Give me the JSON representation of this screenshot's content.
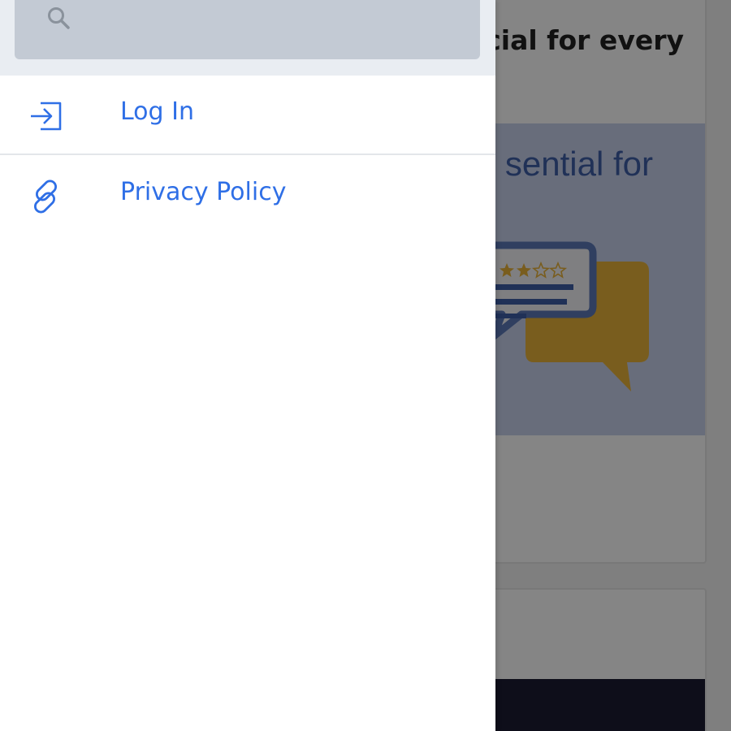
{
  "drawer": {
    "search": {
      "value": "",
      "placeholder": "",
      "icon": "search-icon"
    },
    "items": [
      {
        "label": "Log In",
        "icon": "login-icon"
      },
      {
        "label": "Privacy Policy",
        "icon": "link-icon"
      }
    ]
  },
  "background": {
    "card_title": "cial for every",
    "hero_text": "sential for",
    "rating_stars_filled": 2,
    "rating_stars_total": 5
  },
  "colors": {
    "accent": "#2f6fe6",
    "search_bg": "#c3cad4",
    "search_area_bg": "#e9edf2",
    "hero_bg": "#c7d1ec",
    "bubble_gold": "#e9b33a",
    "bubble_blue": "#3f5fa8"
  }
}
